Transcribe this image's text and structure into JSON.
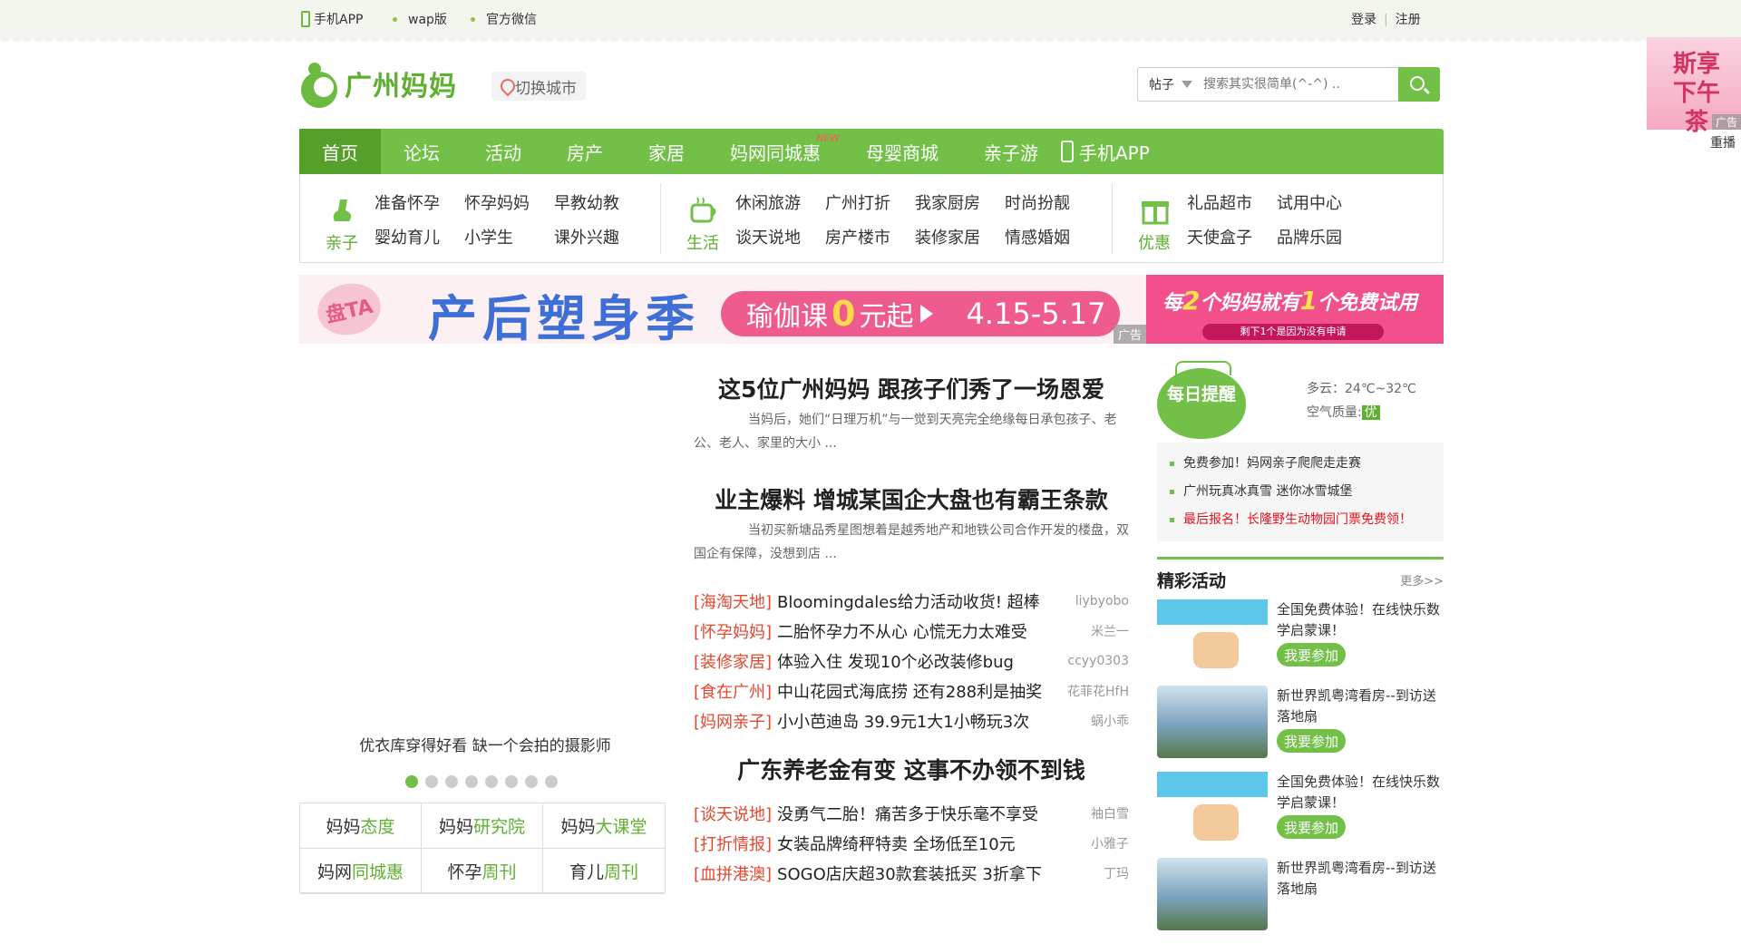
{
  "topbar": {
    "links": [
      "手机APP",
      "wap版",
      "官方微信"
    ],
    "login": "登录",
    "register": "注册"
  },
  "header": {
    "logo_text": "广州妈妈",
    "city_switch": "切换城市",
    "search": {
      "type": "帖子",
      "placeholder": "搜索其实很简单(^-^) .."
    }
  },
  "side_ad": {
    "text": "斯享下午茶",
    "ad_label": "广告",
    "replay": "重播"
  },
  "nav": {
    "items": [
      "首页",
      "论坛",
      "活动",
      "房产",
      "家居",
      "妈网同城惠",
      "母婴商城",
      "亲子游",
      "手机APP"
    ],
    "new_badge": "NEW"
  },
  "subnav": [
    {
      "caption": "亲子",
      "links": [
        "准备怀孕",
        "怀孕妈妈",
        "早教幼教",
        "婴幼育儿",
        "小学生",
        "课外兴趣"
      ]
    },
    {
      "caption": "生活",
      "links": [
        "休闲旅游",
        "广州打折",
        "我家厨房",
        "时尚扮靓",
        "谈天说地",
        "房产楼市",
        "装修家居",
        "情感婚姻"
      ]
    },
    {
      "caption": "优惠",
      "links": [
        "礼品超市",
        "试用中心",
        "天使盒子",
        "品牌乐园"
      ]
    }
  ],
  "banner": {
    "badge": "盘TA",
    "title": "产后塑身季",
    "pill_prefix": "瑜伽课",
    "pill_zero": "0",
    "pill_suffix": "元起",
    "date": "4.15-5.17",
    "ad_label": "广告",
    "side_line1_a": "每",
    "side_line1_n1": "2",
    "side_line1_b": "个妈妈就有",
    "side_line1_n2": "1",
    "side_line1_c": "个免费试用",
    "side_line2": "剩下1个是因为没有申请"
  },
  "slider": {
    "caption": "优衣库穿得好看 缺一个会拍的摄影师",
    "dot_count": 8,
    "active_index": 0
  },
  "mama_grid": [
    {
      "pre": "妈妈",
      "hl": "态度"
    },
    {
      "pre": "妈妈",
      "hl": "研究院"
    },
    {
      "pre": "妈妈",
      "hl": "大课堂"
    },
    {
      "pre": "妈网",
      "hl": "同城惠"
    },
    {
      "pre": "怀孕",
      "hl": "周刊"
    },
    {
      "pre": "育儿",
      "hl": "周刊"
    }
  ],
  "headlines": [
    {
      "title": "这5位广州妈妈 跟孩子们秀了一场恩爱",
      "summary": "当妈后，她们“日理万机”与一觉到天亮完全绝缘每日承包孩子、老公、老人、家里的大小 ..."
    },
    {
      "title": "业主爆料 增城某国企大盘也有霸王条款",
      "summary": "当初买新塘品秀星图想着是越秀地产和地铁公司合作开发的楼盘，双国企有保障，没想到店 ..."
    }
  ],
  "news1": [
    {
      "tag": "[海淘天地]",
      "title": "Bloomingdales给力活动收货! 超棒",
      "author": "liybyobo"
    },
    {
      "tag": "[怀孕妈妈]",
      "title": "二胎怀孕力不从心 心慌无力太难受",
      "author": "米兰一"
    },
    {
      "tag": "[装修家居]",
      "title": "体验入住 发现10个必改装修bug",
      "author": "ccyy0303"
    },
    {
      "tag": "[食在广州]",
      "title": "中山花园式海底捞 还有288利是抽奖",
      "author": "花菲花HfH"
    },
    {
      "tag": "[妈网亲子]",
      "title": "小小芭迪岛 39.9元1大1小畅玩3次",
      "author": "蜗小乖"
    }
  ],
  "headline3": "广东养老金有变 这事不办领不到钱",
  "news2": [
    {
      "tag": "[谈天说地]",
      "title": "没勇气二胎！痛苦多于快乐毫不享受",
      "author": "袖白雪"
    },
    {
      "tag": "[打折情报]",
      "title": "女装品牌绮秤特卖 全场低至10元",
      "author": "小雅子"
    },
    {
      "tag": "[血拼港澳]",
      "title": "SOGO店庆超30款套装抵买 3折拿下",
      "author": "丁玛"
    }
  ],
  "reminder": {
    "badge": "每日提醒",
    "weather": "多云：24℃~32℃",
    "air_label": "空气质量:",
    "air_value": "优",
    "items": [
      {
        "text": "免费参加！妈网亲子爬爬走走赛",
        "red": false
      },
      {
        "text": "广州玩真冰真雪  迷你冰雪城堡",
        "red": false
      },
      {
        "text": "最后报名！长隆野生动物园门票免费领！",
        "red": true
      }
    ]
  },
  "activities": {
    "title": "精彩活动",
    "more": "更多>>",
    "join_label": "我要参加",
    "items": [
      {
        "text": "全国免费体验！在线快乐数学启蒙课！",
        "thumb": "edu"
      },
      {
        "text": "新世界凯粤湾看房--到访送落地扇",
        "thumb": "city"
      },
      {
        "text": "全国免费体验！在线快乐数学启蒙课！",
        "thumb": "edu"
      },
      {
        "text": "新世界凯粤湾看房--到访送落地扇",
        "thumb": "city"
      }
    ]
  },
  "colors": {
    "brand_green": "#72c048",
    "dark_green": "#55a02b",
    "tag_red": "#e5462e"
  }
}
